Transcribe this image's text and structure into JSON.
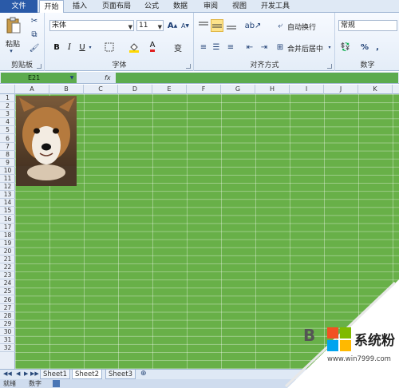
{
  "tabs": {
    "file": "文件",
    "items": [
      "开始",
      "插入",
      "页面布局",
      "公式",
      "数据",
      "审阅",
      "视图",
      "开发工具"
    ],
    "active": "开始"
  },
  "ribbon": {
    "clipboard": {
      "paste_label": "粘贴",
      "group_label": "剪贴板"
    },
    "font": {
      "font_name": "宋体",
      "font_size": "11",
      "bold": "B",
      "italic": "I",
      "underline": "U",
      "font_color_glyph": "A",
      "grow": "A",
      "shrink": "A",
      "wen": "变",
      "group_label": "字体"
    },
    "alignment": {
      "wrap_text": "自动换行",
      "merge_center": "合并后居中",
      "group_label": "对齐方式"
    },
    "number": {
      "format": "常规",
      "percent": "%",
      "comma": ",",
      "group_label": "数字"
    }
  },
  "formula_bar": {
    "name_box": "E21",
    "fx": "fx",
    "value": ""
  },
  "grid": {
    "columns": [
      "A",
      "B",
      "C",
      "D",
      "E",
      "F",
      "G",
      "H",
      "I",
      "J",
      "K"
    ],
    "rows": [
      "1",
      "2",
      "3",
      "4",
      "5",
      "6",
      "7",
      "8",
      "9",
      "10",
      "11",
      "12",
      "13",
      "14",
      "15",
      "16",
      "17",
      "18",
      "19",
      "20",
      "21",
      "22",
      "23",
      "24",
      "25",
      "26",
      "27",
      "28",
      "29",
      "30",
      "31",
      "32"
    ]
  },
  "sheets": {
    "items": [
      "Sheet1",
      "Sheet2",
      "Sheet3"
    ],
    "active": "Sheet2"
  },
  "status": {
    "ready": "就绪",
    "numlock": "数字"
  },
  "watermark": {
    "brand": "系统粉",
    "url": "www.win7999.com",
    "partial_b": "B"
  },
  "colors": {
    "sheet_bg": "#68b048",
    "file_tab": "#2a5aa8"
  }
}
